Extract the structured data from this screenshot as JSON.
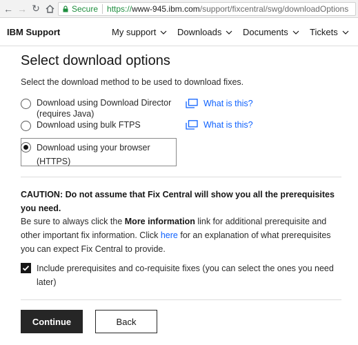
{
  "browser": {
    "secure_label": "Secure",
    "url_proto": "https://",
    "url_host": "www-945.ibm.com",
    "url_path": "/support/fixcentral/swg/downloadOptions"
  },
  "header": {
    "brand": "IBM Support",
    "menu": [
      {
        "label": "My support"
      },
      {
        "label": "Downloads"
      },
      {
        "label": "Documents"
      },
      {
        "label": "Tickets"
      }
    ]
  },
  "page": {
    "title": "Select download options",
    "intro": "Select the download method to be used to download fixes.",
    "options": [
      {
        "label_line1": "Download using Download Director",
        "label_line2": "(requires Java)",
        "selected": false,
        "help": "What is this?"
      },
      {
        "label_line1": "Download using bulk FTPS",
        "selected": false,
        "help": "What is this?"
      },
      {
        "label_line1": "Download using your browser",
        "label_line2": "(HTTPS)",
        "selected": true
      }
    ],
    "caution": "CAUTION: Do not assume that Fix Central will show you all the prerequisites you need.",
    "para_prefix": "Be sure to always click the ",
    "para_bold": "More information",
    "para_mid": " link for additional prerequisite and other important fix information. Click ",
    "para_link": "here",
    "para_suffix": " for an explanation of what prerequisites you can expect Fix Central to provide.",
    "checkbox_label": "Include prerequisites and co-requisite fixes (you can select the ones you need later)",
    "checkbox_checked": true,
    "continue_label": "Continue",
    "back_label": "Back"
  }
}
